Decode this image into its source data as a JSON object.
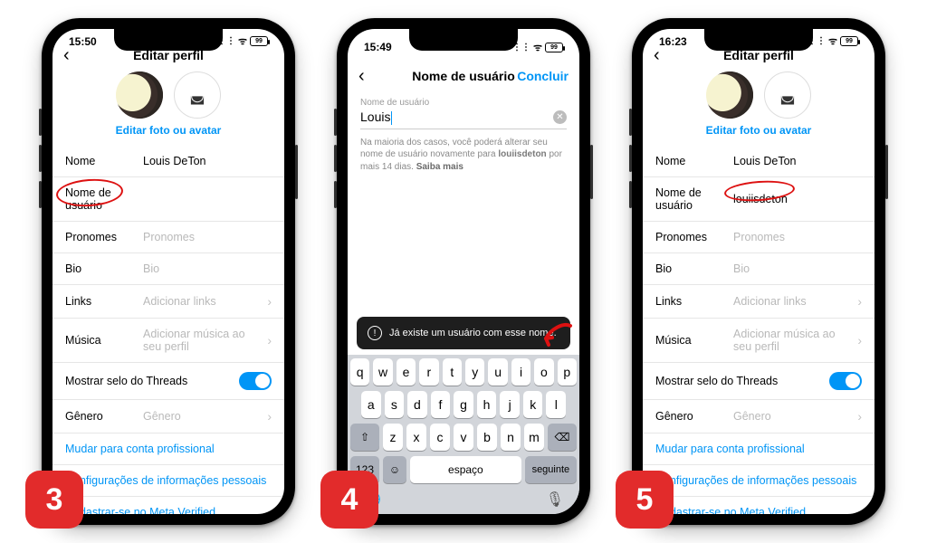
{
  "colors": {
    "accent": "#0095f6",
    "badge": "#e22b2b",
    "annotation": "#d11"
  },
  "common": {
    "signal_icon": "signal-icon",
    "wifi_icon": "wifi-icon",
    "battery_level": "99"
  },
  "screens": [
    {
      "step": "3",
      "status_time": "15:50",
      "nav": {
        "title": "Editar perfil",
        "back": "‹"
      },
      "avatar": {
        "edit_link": "Editar foto ou avatar",
        "circ_icon": "avatar-style-icon"
      },
      "rows": {
        "name": {
          "label": "Nome",
          "value": "Louis DeTon"
        },
        "username": {
          "label": "Nome de usuário",
          "value": ""
        },
        "pronouns": {
          "label": "Pronomes",
          "placeholder": "Pronomes"
        },
        "bio": {
          "label": "Bio",
          "placeholder": "Bio"
        },
        "links": {
          "label": "Links",
          "placeholder": "Adicionar links"
        },
        "music": {
          "label": "Música",
          "placeholder": "Adicionar música ao seu perfil"
        },
        "threads": {
          "label": "Mostrar selo do Threads",
          "toggle": true
        },
        "gender": {
          "label": "Gênero",
          "placeholder": "Gênero"
        }
      },
      "links": {
        "pro": "Mudar para conta profissional",
        "info": "Configurações de informações pessoais",
        "meta": "Cadastrar-se no Meta Verified"
      },
      "annotation_target": "username-label"
    },
    {
      "step": "4",
      "status_time": "15:49",
      "nav": {
        "title": "Nome de usuário",
        "back": "‹",
        "action": "Concluir"
      },
      "field": {
        "label": "Nome de usuário",
        "value": "Louis"
      },
      "hint": {
        "prefix": "Na maioria dos casos, você poderá alterar seu nome de usuário novamente para ",
        "bold": "louiisdeton",
        "suffix": " por mais 14 dias. ",
        "more": "Saiba mais"
      },
      "toast": "Já existe um usuário com esse nome.",
      "keyboard": {
        "r1": [
          "q",
          "w",
          "e",
          "r",
          "t",
          "y",
          "u",
          "i",
          "o",
          "p"
        ],
        "r2": [
          "a",
          "s",
          "d",
          "f",
          "g",
          "h",
          "j",
          "k",
          "l"
        ],
        "r3": [
          "z",
          "x",
          "c",
          "v",
          "b",
          "n",
          "m"
        ],
        "shift": "⇧",
        "back": "⌫",
        "num": "123",
        "emoji": "☺",
        "space": "espaço",
        "return": "seguinte",
        "globe": "🌐",
        "mic": "🎙"
      }
    },
    {
      "step": "5",
      "status_time": "16:23",
      "nav": {
        "title": "Editar perfil",
        "back": "‹"
      },
      "avatar": {
        "edit_link": "Editar foto ou avatar",
        "circ_icon": "avatar-style-icon"
      },
      "rows": {
        "name": {
          "label": "Nome",
          "value": "Louis DeTon"
        },
        "username": {
          "label": "Nome de usuário",
          "value": "louiisdeton"
        },
        "pronouns": {
          "label": "Pronomes",
          "placeholder": "Pronomes"
        },
        "bio": {
          "label": "Bio",
          "placeholder": "Bio"
        },
        "links": {
          "label": "Links",
          "placeholder": "Adicionar links"
        },
        "music": {
          "label": "Música",
          "placeholder": "Adicionar música ao seu perfil"
        },
        "threads": {
          "label": "Mostrar selo do Threads",
          "toggle": true
        },
        "gender": {
          "label": "Gênero",
          "placeholder": "Gênero"
        }
      },
      "links": {
        "pro": "Mudar para conta profissional",
        "info": "Configurações de informações pessoais",
        "meta": "Cadastrar-se no Meta Verified"
      },
      "annotation_target": "username-value"
    }
  ]
}
